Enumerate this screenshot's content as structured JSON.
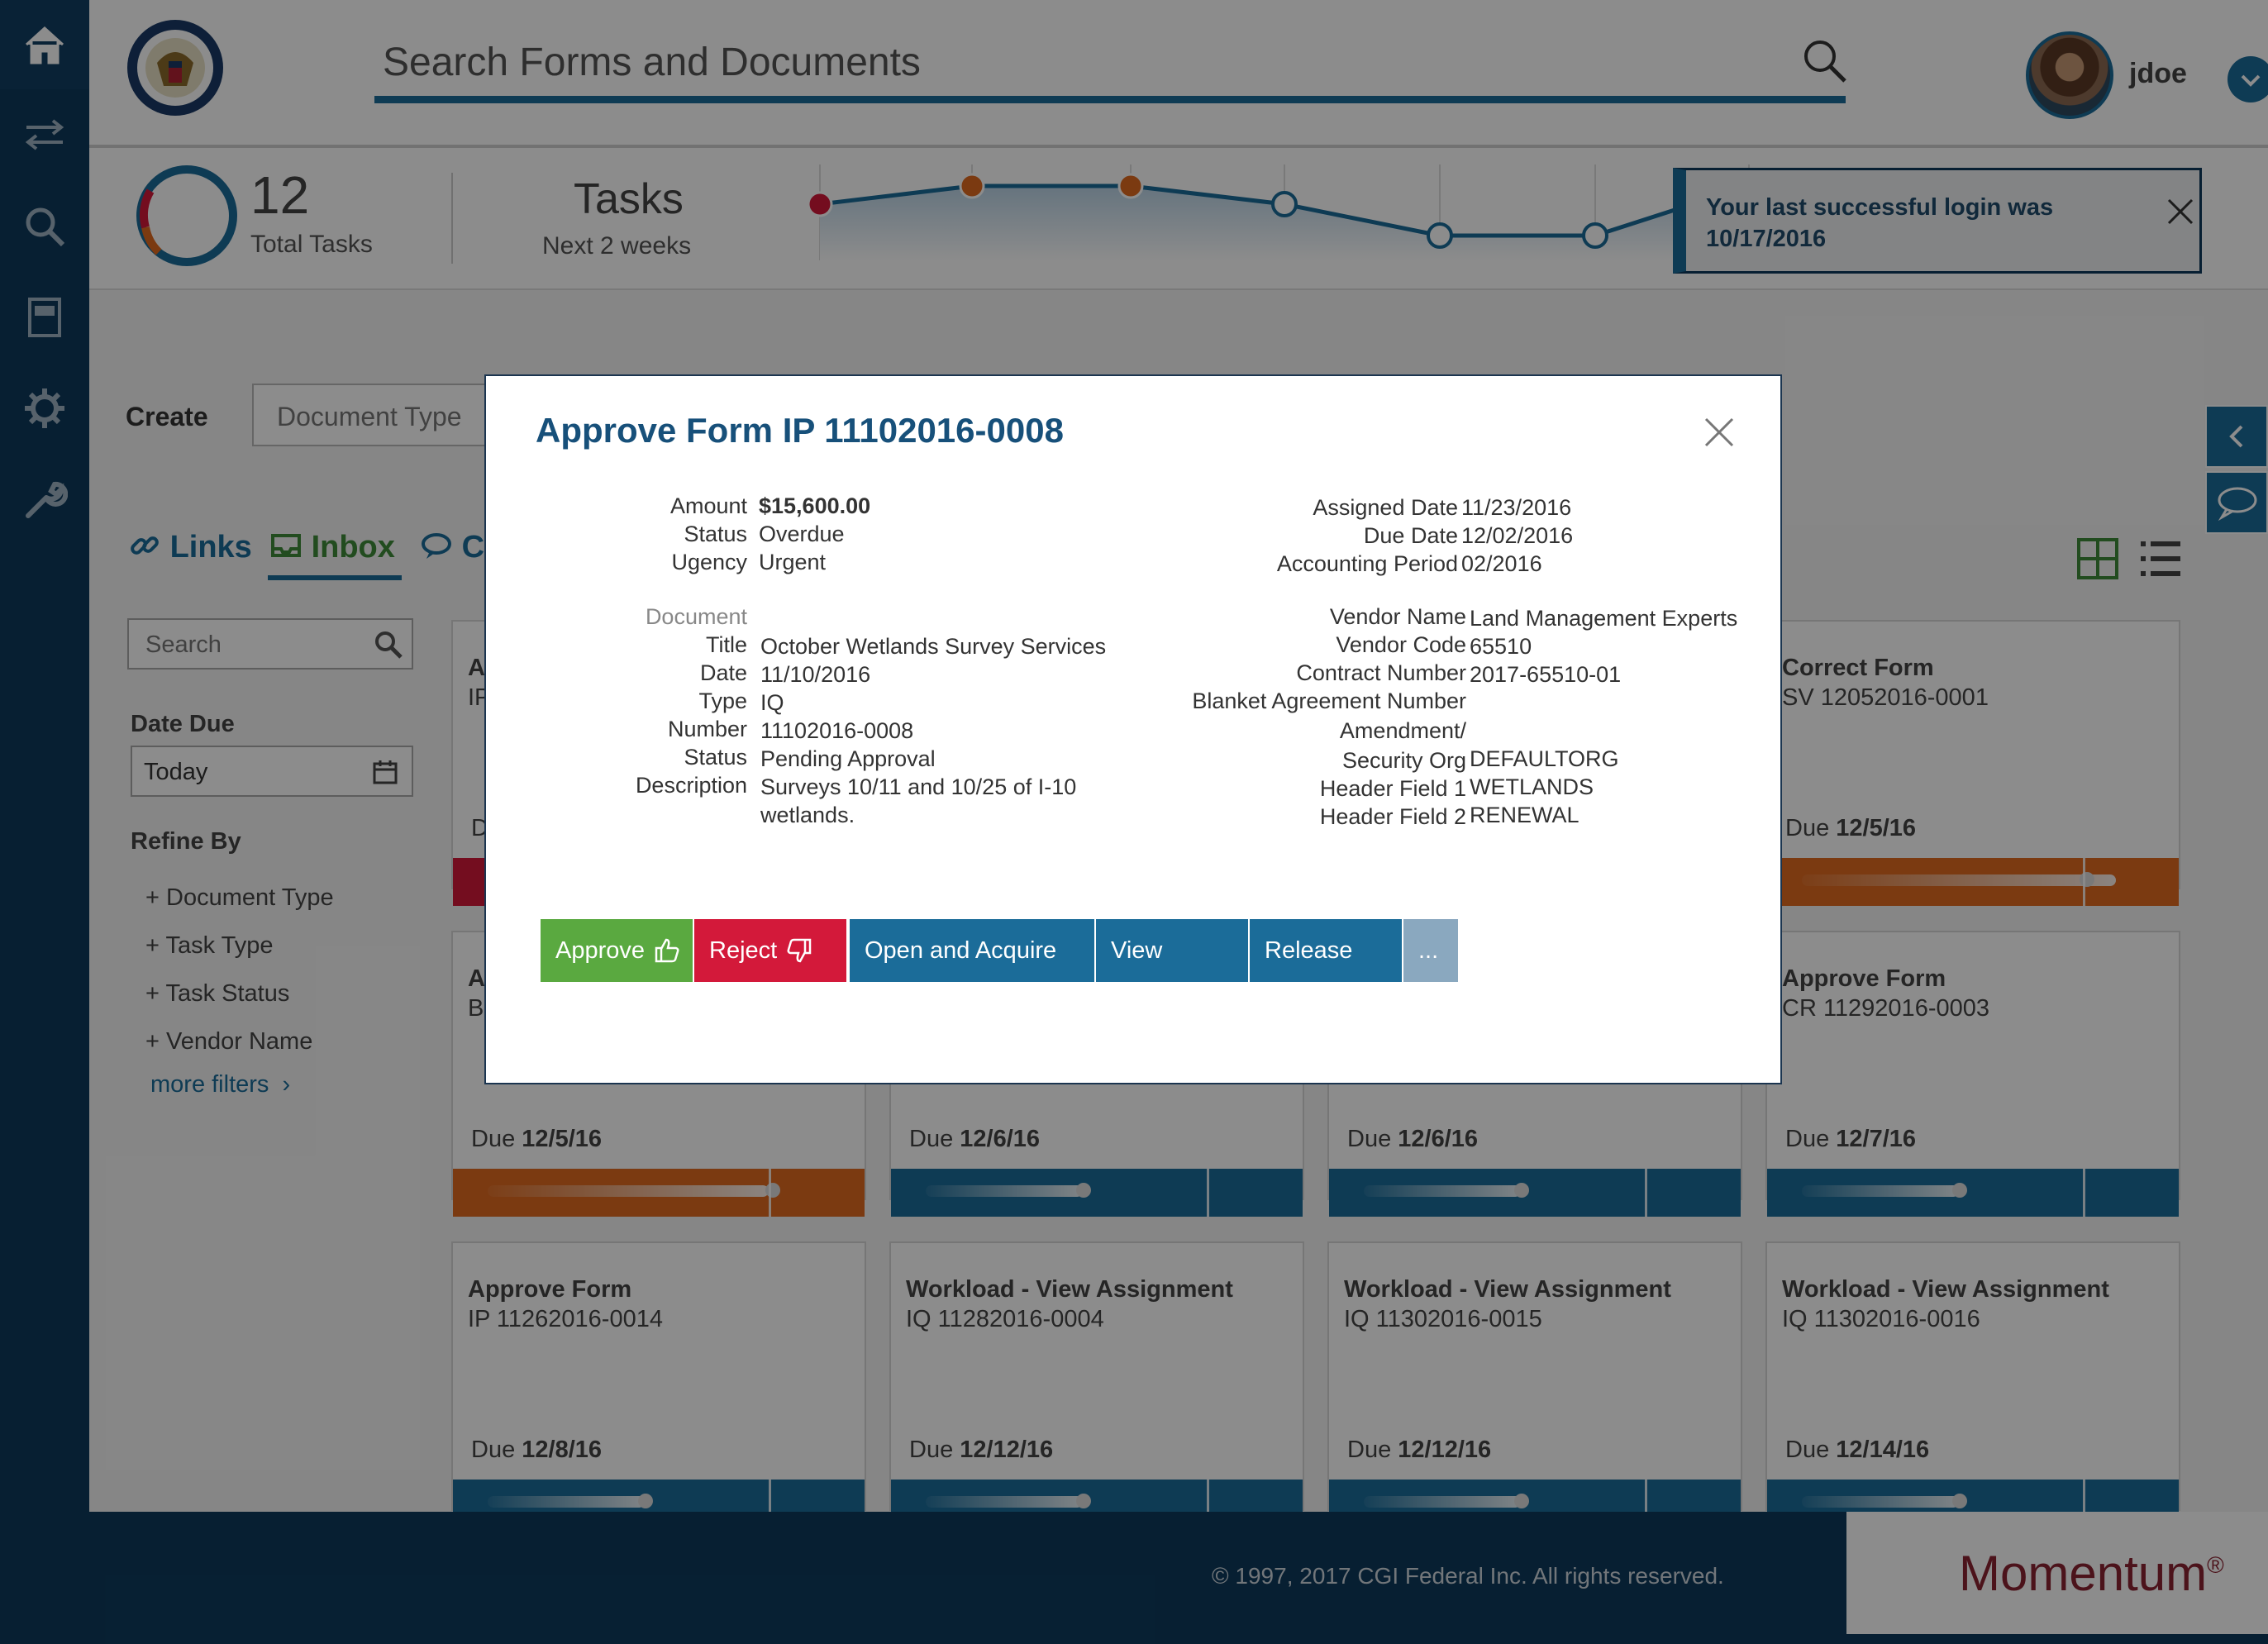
{
  "header": {
    "search_placeholder": "Search Forms and Documents",
    "username": "jdoe"
  },
  "stats": {
    "total_count": "12",
    "total_label": "Total Tasks",
    "tasks_title": "Tasks",
    "tasks_subtitle": "Next 2 weeks"
  },
  "toast": {
    "message_line1": "Your last successful login was",
    "message_line2": "10/17/2016"
  },
  "create": {
    "label": "Create",
    "placeholder": "Document Type"
  },
  "tabs": [
    {
      "label": "Links"
    },
    {
      "label": "Inbox"
    },
    {
      "label": "Co"
    }
  ],
  "sidebar": {
    "search_placeholder": "Search",
    "date_due_label": "Date Due",
    "date_due_value": "Today",
    "refine_label": "Refine By",
    "filters": [
      {
        "label": "Document Type"
      },
      {
        "label": "Task Type"
      },
      {
        "label": "Task Status"
      },
      {
        "label": "Vendor Name"
      }
    ],
    "more_filters": "more filters"
  },
  "cards_row1_partial": {
    "c1_title": "Ap",
    "c1_sub": "IP",
    "c1_due_prefix": "D",
    "c4_title": "Correct Form",
    "c4_sub": "SV 12052016-0001",
    "c4_due": "12/5/16"
  },
  "cards_row2": [
    {
      "title": "Ac",
      "sub": "Bl",
      "due": "12/5/16"
    },
    {
      "title": "",
      "sub": "",
      "due": "12/6/16"
    },
    {
      "title": "",
      "sub": "",
      "due": "12/6/16"
    },
    {
      "title": "Approve Form",
      "sub": "CR 11292016-0003",
      "due": "12/7/16"
    }
  ],
  "cards_row3": [
    {
      "title": "Approve Form",
      "sub": "IP 11262016-0014",
      "due": "12/8/16"
    },
    {
      "title": "Workload - View Assignment",
      "sub": "IQ 11282016-0004",
      "due": "12/12/16"
    },
    {
      "title": "Workload - View Assignment",
      "sub": "IQ 11302016-0015",
      "due": "12/12/16"
    },
    {
      "title": "Workload - View Assignment",
      "sub": "IQ 11302016-0016",
      "due": "12/14/16"
    }
  ],
  "due_prefix": "Due",
  "footer": {
    "copyright": "© 1997, 2017 CGI Federal Inc. All rights reserved.",
    "brand": "Momentum",
    "brand_mark": "®"
  },
  "modal": {
    "title": "Approve Form IP 11102016-0008",
    "left_top": [
      {
        "label": "Amount",
        "value": "$15,600.00"
      },
      {
        "label": "Status",
        "value": "Overdue"
      },
      {
        "label": "Ugency",
        "value": "Urgent"
      }
    ],
    "document_heading": "Document",
    "document": [
      {
        "label": "Title",
        "value": "October Wetlands Survey Services"
      },
      {
        "label": "Date",
        "value": "11/10/2016"
      },
      {
        "label": "Type",
        "value": "IQ"
      },
      {
        "label": "Number",
        "value": "11102016-0008"
      },
      {
        "label": "Status",
        "value": "Pending Approval"
      },
      {
        "label": "Description",
        "value": "Surveys 10/11 and 10/25 of I-10",
        "value2": "wetlands."
      }
    ],
    "right_top": [
      {
        "label": "Assigned Date",
        "value": "11/23/2016"
      },
      {
        "label": "Due Date",
        "value": "12/02/2016"
      },
      {
        "label": "Accounting Period",
        "value": "02/2016"
      }
    ],
    "vendor": [
      {
        "label": "Vendor Name",
        "value": "Land Management Experts"
      },
      {
        "label": "Vendor Code",
        "value": "65510"
      },
      {
        "label": "Contract Number",
        "value": "2017-65510-01"
      },
      {
        "label": "Blanket Agreement Number",
        "value": ""
      },
      {
        "label": "Amendment/",
        "value": ""
      },
      {
        "label": "Security Org",
        "value": "DEFAULTORG"
      },
      {
        "label": "Header Field 1",
        "value": "WETLANDS"
      },
      {
        "label": "Header Field 2",
        "value": "RENEWAL"
      }
    ],
    "actions": {
      "approve": "Approve",
      "reject": "Reject",
      "open_acquire": "Open and Acquire",
      "view": "View",
      "release": "Release",
      "more": "..."
    }
  },
  "colors": {
    "navy": "#0d3a5c",
    "primary_blue": "#1b6c99",
    "approve_green": "#5aa940",
    "reject_red": "#d3193a",
    "overdue_orange": "#e06a1f",
    "brand_red": "#8b2332"
  },
  "icons": [
    "home-icon",
    "transfer-icon",
    "search-icon",
    "document-icon",
    "gear-icon",
    "wrench-icon",
    "seal-logo",
    "chevron-down-icon",
    "close-icon",
    "link-icon",
    "inbox-icon",
    "comment-icon",
    "calendar-icon",
    "plus-icon",
    "chevron-right-icon",
    "grid-view-icon",
    "list-view-icon",
    "chevron-left-icon",
    "chat-icon",
    "thumbs-up-icon",
    "thumbs-down-icon"
  ]
}
